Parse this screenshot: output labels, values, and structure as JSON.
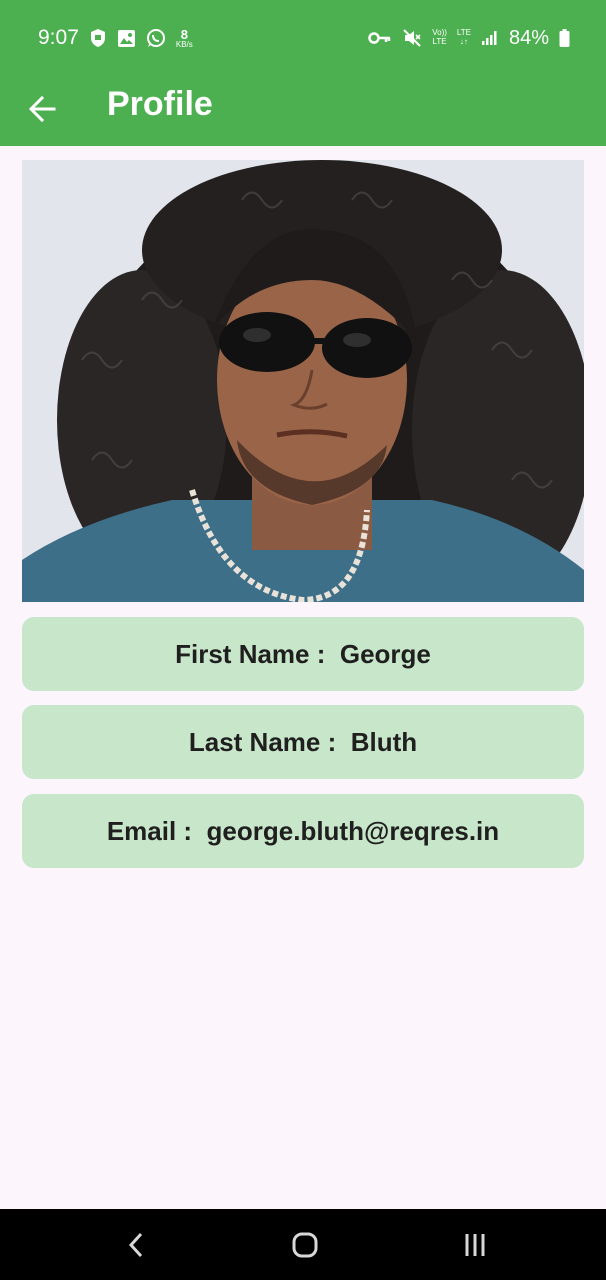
{
  "status_bar": {
    "time": "9:07",
    "speed_value": "8",
    "speed_unit": "KB/s",
    "volte_top": "Vo))",
    "volte_bottom": "LTE",
    "lte_top": "LTE",
    "lte_bottom": "↓↑",
    "battery": "84%",
    "icons": [
      "shield-icon",
      "gallery-icon",
      "whatsapp-icon",
      "vpn-key-icon",
      "mute-icon",
      "signal-icon",
      "battery-icon"
    ]
  },
  "app_bar": {
    "title": "Profile",
    "back_icon": "arrow-left-icon"
  },
  "profile": {
    "photo": "profile-photo",
    "first_name_label": "First Name :",
    "first_name": "George",
    "last_name_label": "Last Name :",
    "last_name": "Bluth",
    "email_label": "Email :",
    "email": "george.bluth@reqres.in"
  },
  "colors": {
    "primary": "#4caf50",
    "card": "#c8e6c9",
    "background": "#fcf6fc"
  },
  "nav_bar": {
    "icons": [
      "back-nav-icon",
      "home-nav-icon",
      "recents-nav-icon"
    ]
  }
}
